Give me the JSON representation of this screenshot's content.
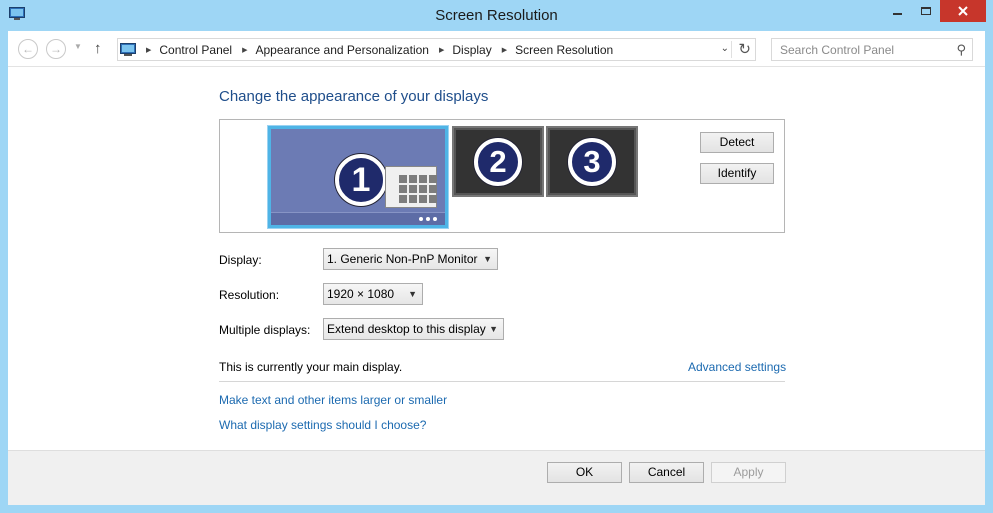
{
  "window": {
    "title": "Screen Resolution",
    "app_icon": "monitor-icon",
    "close_color": "#c7362b"
  },
  "navigation": {
    "back_icon": "back-arrow-icon",
    "forward_icon": "forward-arrow-icon",
    "up_icon": "up-arrow-icon",
    "breadcrumbs": [
      "Control Panel",
      "Appearance and Personalization",
      "Display",
      "Screen Resolution"
    ],
    "search_placeholder": "Search Control Panel"
  },
  "main": {
    "heading": "Change the appearance of your displays",
    "monitors": [
      {
        "number": "1",
        "selected": true
      },
      {
        "number": "2",
        "selected": false
      },
      {
        "number": "3",
        "selected": false
      }
    ],
    "detect_label": "Detect",
    "identify_label": "Identify",
    "display_label": "Display:",
    "display_value": "1. Generic Non-PnP Monitor",
    "resolution_label": "Resolution:",
    "resolution_value": "1920 × 1080",
    "multiple_label": "Multiple displays:",
    "multiple_value": "Extend desktop to this display",
    "status_text": "This is currently your main display.",
    "advanced_link": "Advanced settings",
    "link_text_size": "Make text and other items larger or smaller",
    "link_help": "What display settings should I choose?"
  },
  "footer": {
    "ok_label": "OK",
    "cancel_label": "Cancel",
    "apply_label": "Apply"
  },
  "colors": {
    "accent_link": "#1c6ab0",
    "heading": "#1f4e8b",
    "frame": "#9ed6f5"
  }
}
